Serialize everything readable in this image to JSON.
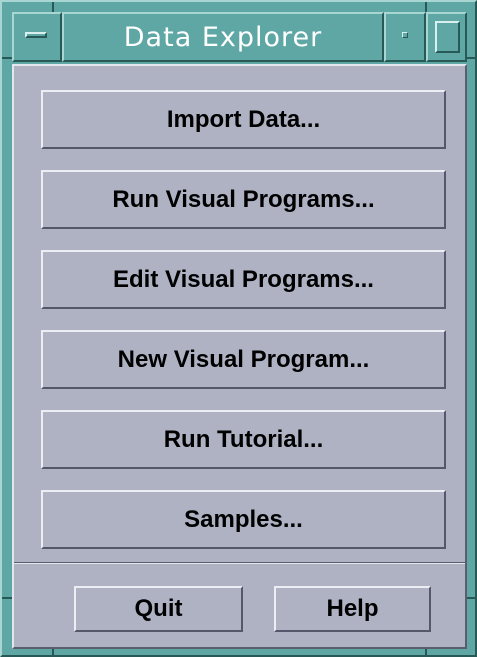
{
  "window": {
    "title": "Data Explorer"
  },
  "main_buttons": [
    {
      "label": "Import Data..."
    },
    {
      "label": "Run Visual Programs..."
    },
    {
      "label": "Edit Visual Programs..."
    },
    {
      "label": "New Visual Program..."
    },
    {
      "label": "Run Tutorial..."
    },
    {
      "label": "Samples..."
    }
  ],
  "footer": {
    "quit_label": "Quit",
    "help_label": "Help"
  },
  "colors": {
    "frame": "#5fa7a4",
    "client_background": "#aeb2c3",
    "title_text": "#ffffff"
  },
  "icons": {
    "window_menu": "window-menu-icon",
    "minimize": "minimize-icon",
    "maximize": "maximize-icon"
  }
}
